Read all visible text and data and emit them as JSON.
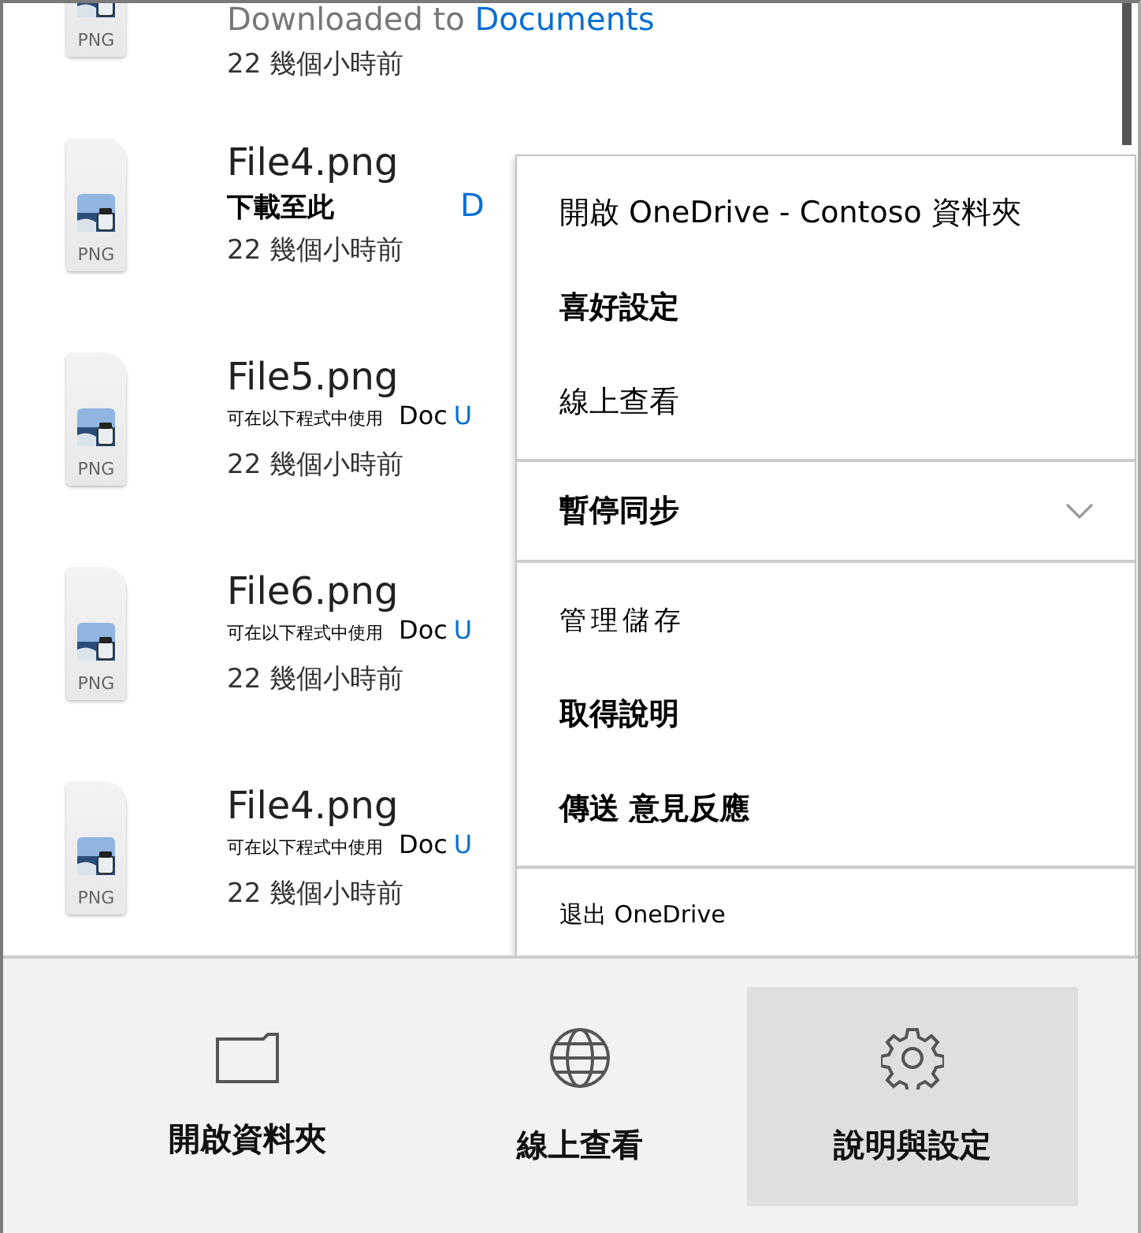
{
  "files": [
    {
      "file_type": "PNG",
      "status": {
        "kind": "downloaded",
        "text": "Downloaded to ",
        "link": "Documents"
      },
      "time": "22 幾個小時前"
    },
    {
      "name": "File4.png",
      "file_type": "PNG",
      "status": {
        "kind": "here",
        "text": "下載至此",
        "link": "D"
      },
      "time": "22 幾個小時前"
    },
    {
      "name": "File5.png",
      "file_type": "PNG",
      "status": {
        "kind": "available",
        "text": "可在以下程式中使用",
        "location": "Doc",
        "link": "U"
      },
      "time": "22 幾個小時前"
    },
    {
      "name": "File6.png",
      "file_type": "PNG",
      "status": {
        "kind": "available",
        "text": "可在以下程式中使用",
        "location": "Doc",
        "link": "U"
      },
      "time": "22 幾個小時前"
    },
    {
      "name": "File4.png",
      "file_type": "PNG",
      "status": {
        "kind": "available",
        "text": "可在以下程式中使用",
        "location": "Doc",
        "link": "U"
      },
      "time": "22 幾個小時前"
    }
  ],
  "menu": [
    [
      {
        "label": "開啟 OneDrive - Contoso 資料夾",
        "kind": "normal"
      },
      {
        "label": "喜好設定",
        "kind": "bold"
      },
      {
        "label": "線上查看",
        "kind": "normal"
      }
    ],
    [
      {
        "label": "暫停同步",
        "kind": "bold",
        "expanded": false
      }
    ],
    [
      {
        "label": "管理儲存",
        "kind": "light"
      },
      {
        "label": "取得說明",
        "kind": "bold"
      },
      {
        "label": "傳送  意見反應",
        "kind": "bold"
      }
    ],
    [
      {
        "label": "退出 OneDrive",
        "kind": "small"
      }
    ]
  ],
  "bottom_bar": [
    {
      "label": "開啟資料夾",
      "selected": false
    },
    {
      "label": "線上查看",
      "selected": false
    },
    {
      "label": "說明與設定",
      "selected": true
    }
  ]
}
